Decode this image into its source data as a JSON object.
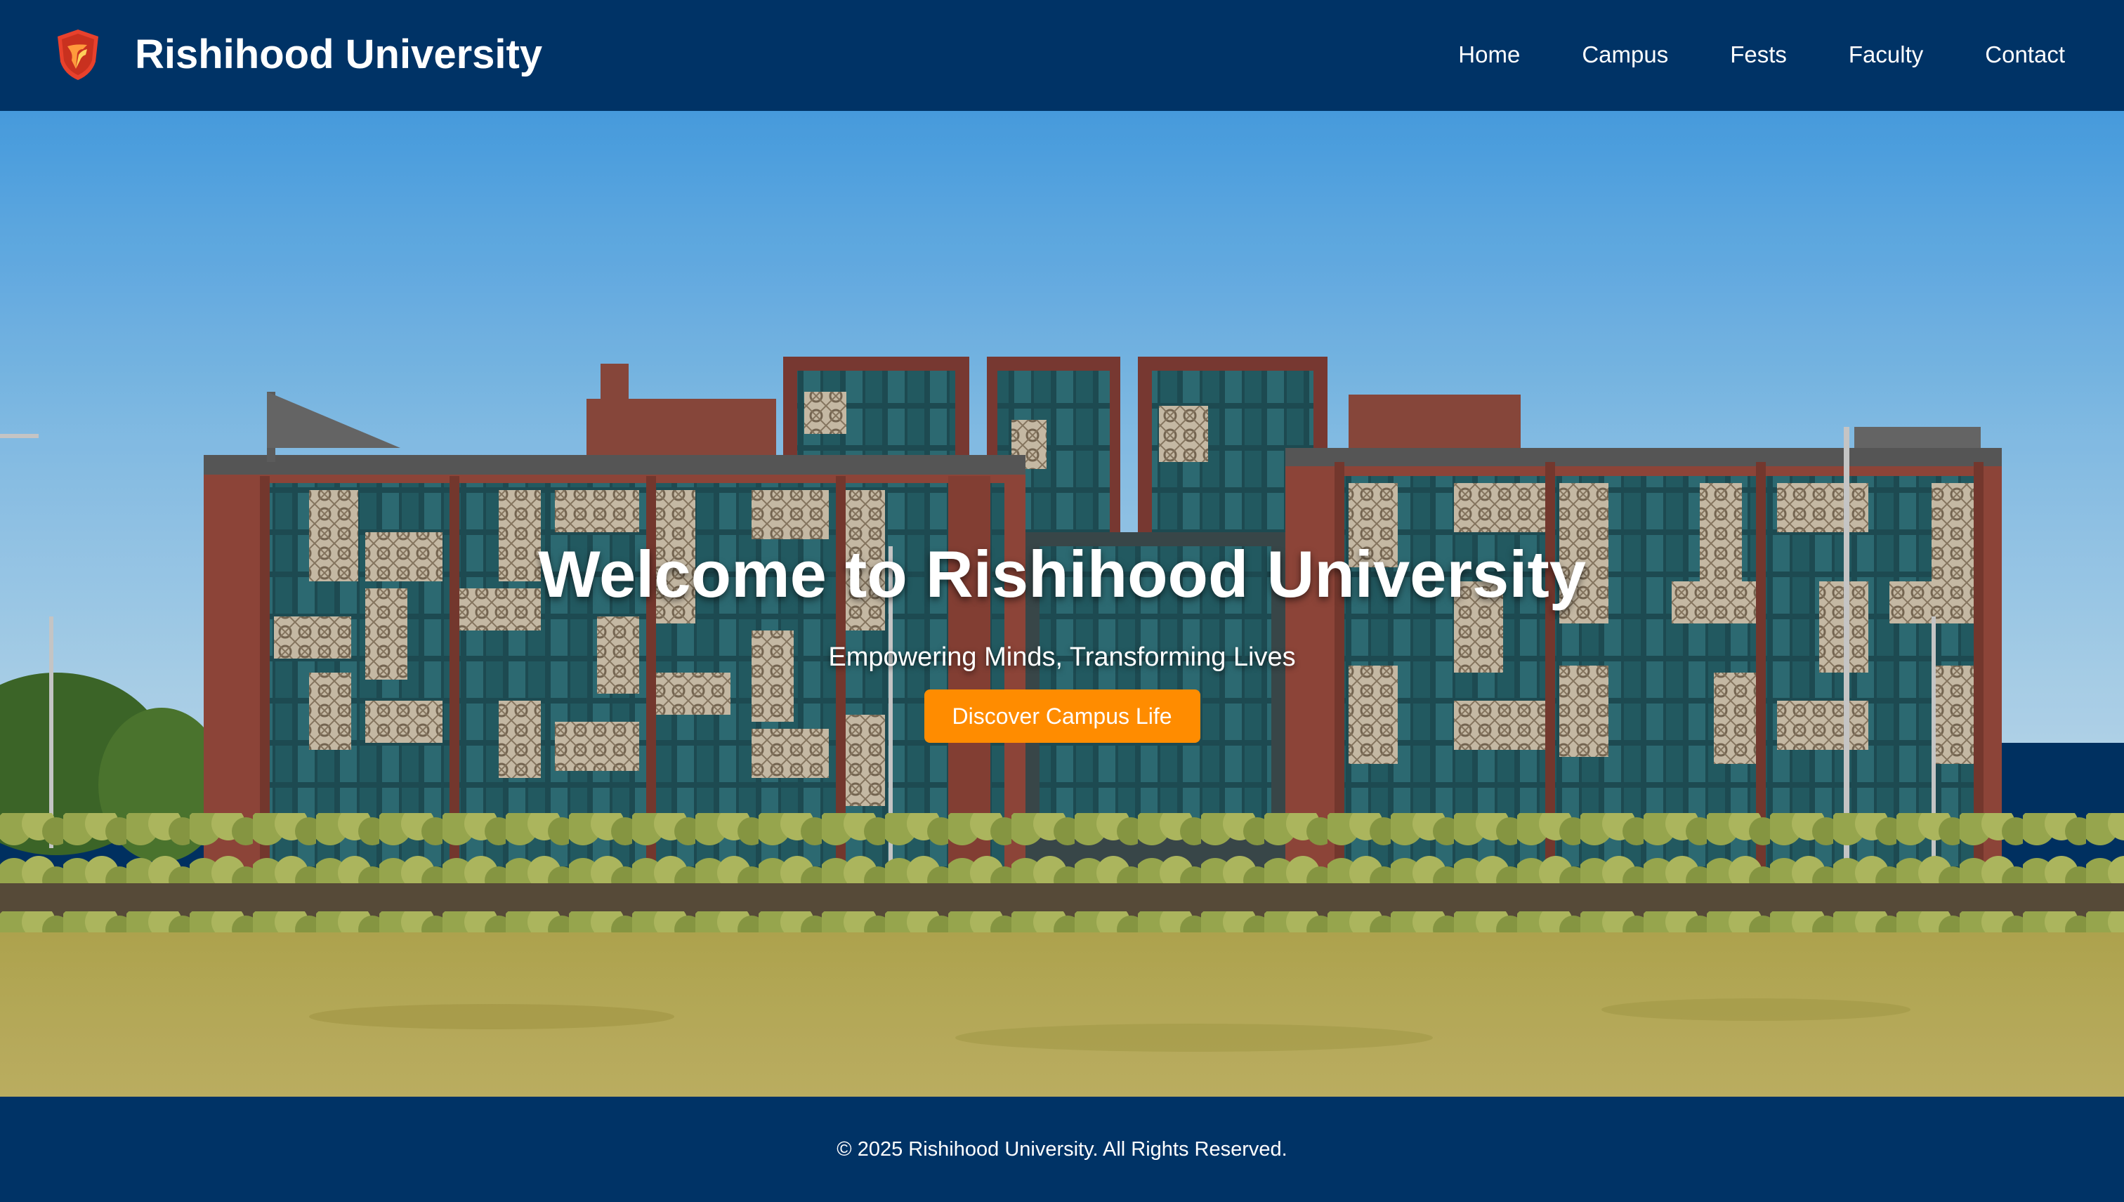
{
  "header": {
    "brand": "Rishihood University",
    "logo_icon": "shield-logo-icon",
    "nav": [
      {
        "label": "Home"
      },
      {
        "label": "Campus"
      },
      {
        "label": "Fests"
      },
      {
        "label": "Faculty"
      },
      {
        "label": "Contact"
      }
    ]
  },
  "hero": {
    "title": "Welcome to Rishihood University",
    "subtitle": "Empowering Minds, Transforming Lives",
    "cta_label": "Discover Campus Life",
    "background": "campus building photo"
  },
  "footer": {
    "copyright": "© 2025 Rishihood University. All Rights Reserved."
  },
  "colors": {
    "primary_navy": "#003366",
    "accent_orange": "#ff8c00",
    "logo_red": "#e8412c",
    "text_white": "#ffffff"
  }
}
